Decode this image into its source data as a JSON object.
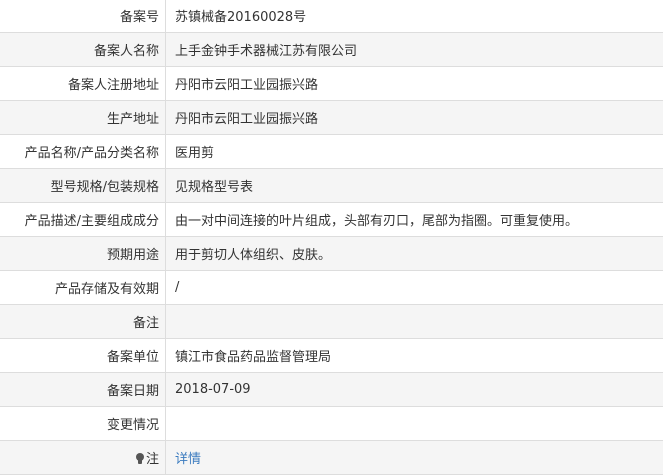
{
  "rows": [
    {
      "label": "备案号",
      "value": "苏镇械备20160028号"
    },
    {
      "label": "备案人名称",
      "value": "上手金钟手术器械江苏有限公司"
    },
    {
      "label": "备案人注册地址",
      "value": "丹阳市云阳工业园振兴路"
    },
    {
      "label": "生产地址",
      "value": "丹阳市云阳工业园振兴路"
    },
    {
      "label": "产品名称/产品分类名称",
      "value": "医用剪"
    },
    {
      "label": "型号规格/包装规格",
      "value": "见规格型号表"
    },
    {
      "label": "产品描述/主要组成成分",
      "value": "由一对中间连接的叶片组成，头部有刃口，尾部为指圈。可重复使用。"
    },
    {
      "label": "预期用途",
      "value": "用于剪切人体组织、皮肤。"
    },
    {
      "label": "产品存储及有效期",
      "value": "/"
    },
    {
      "label": "备注",
      "value": ""
    },
    {
      "label": "备案单位",
      "value": "镇江市食品药品监督管理局"
    },
    {
      "label": "备案日期",
      "value": "2018-07-09"
    },
    {
      "label": "变更情况",
      "value": ""
    }
  ],
  "note": {
    "icon": "lightbulb-icon",
    "label": "注",
    "link_text": "详情",
    "link_color": "#3b7bbf"
  }
}
